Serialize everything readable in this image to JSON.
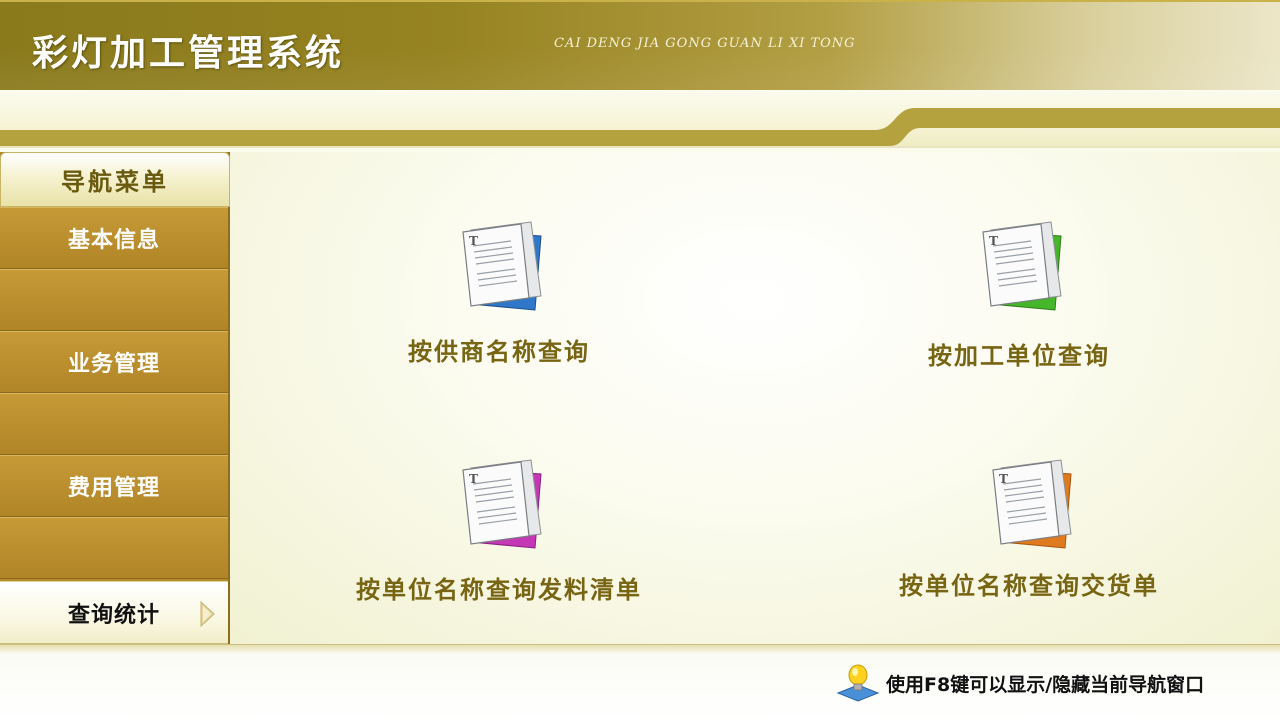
{
  "header": {
    "title": "彩灯加工管理系统",
    "subtitle": "CAI DENG JIA GONG GUAN LI XI TONG"
  },
  "sidebar": {
    "header": "导航菜单",
    "items": [
      {
        "label": "基本信息",
        "active": false
      },
      {
        "label": "",
        "active": false
      },
      {
        "label": "业务管理",
        "active": false
      },
      {
        "label": "",
        "active": false
      },
      {
        "label": "费用管理",
        "active": false
      },
      {
        "label": "",
        "active": false
      },
      {
        "label": "查询统计",
        "active": true
      }
    ]
  },
  "tiles": [
    {
      "label": "按供商名称查询",
      "icon": "document-blue-icon",
      "color": "#2f78c9"
    },
    {
      "label": "按加工单位查询",
      "icon": "document-green-icon",
      "color": "#45b52a"
    },
    {
      "label": "按单位名称查询发料清单",
      "icon": "document-magenta-icon",
      "color": "#c437b5"
    },
    {
      "label": "按单位名称查询交货单",
      "icon": "document-orange-icon",
      "color": "#e07a1e"
    }
  ],
  "footer": {
    "tip": "使用F8键可以显示/隐藏当前导航窗口",
    "tip_icon": "lightbulb-icon"
  },
  "colors": {
    "header_gold": "#8a7a1c",
    "sidebar_gold": "#b38a2c",
    "label_olive": "#786514"
  }
}
